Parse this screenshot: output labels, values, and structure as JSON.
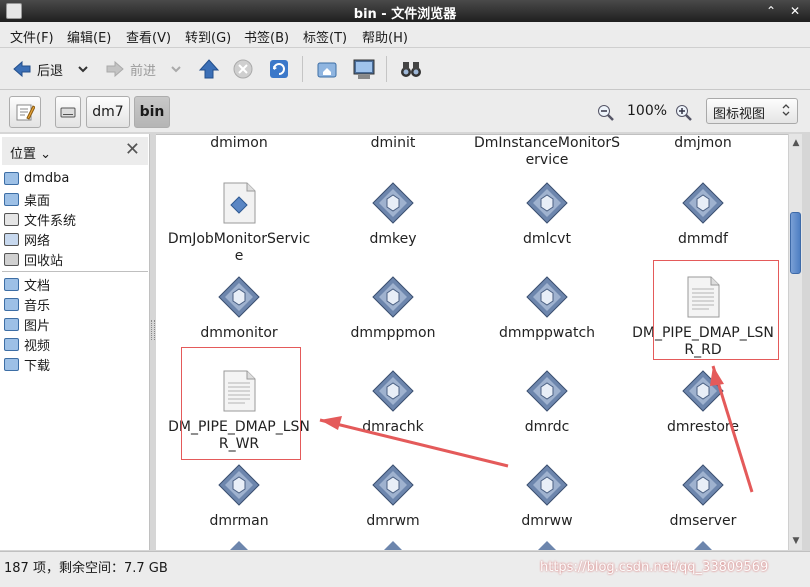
{
  "window": {
    "title": "bin - 文件浏览器",
    "controls": [
      "⌃",
      "✕"
    ]
  },
  "menu": [
    "文件(F)",
    "编辑(E)",
    "查看(V)",
    "转到(G)",
    "书签(B)",
    "标签(T)",
    "帮助(H)"
  ],
  "toolbar": {
    "back_label": "后退",
    "forward_label": "前进"
  },
  "location": {
    "path": [
      "dm7",
      "bin"
    ],
    "zoom": "100%",
    "view_mode": "图标视图"
  },
  "sidebar": {
    "header": "位置",
    "group1": [
      "dmdba",
      "桌面",
      "文件系统",
      "网络",
      "回收站"
    ],
    "group2": [
      "文档",
      "音乐",
      "图片",
      "视频",
      "下载"
    ]
  },
  "files": [
    {
      "name": "dmimon",
      "type": "exec"
    },
    {
      "name": "dminit",
      "type": "exec"
    },
    {
      "name": "DmInstanceMonitorService",
      "type": "exec"
    },
    {
      "name": "dmjmon",
      "type": "exec"
    },
    {
      "name": "DmJobMonitorService",
      "type": "script"
    },
    {
      "name": "dmkey",
      "type": "exec"
    },
    {
      "name": "dmlcvt",
      "type": "exec"
    },
    {
      "name": "dmmdf",
      "type": "exec"
    },
    {
      "name": "dmmonitor",
      "type": "exec"
    },
    {
      "name": "dmmppmon",
      "type": "exec"
    },
    {
      "name": "dmmppwatch",
      "type": "exec"
    },
    {
      "name": "DM_PIPE_DMAP_LSNR_RD",
      "type": "text"
    },
    {
      "name": "DM_PIPE_DMAP_LSNR_WR",
      "type": "text"
    },
    {
      "name": "dmrachk",
      "type": "exec"
    },
    {
      "name": "dmrdc",
      "type": "exec"
    },
    {
      "name": "dmrestore",
      "type": "exec"
    },
    {
      "name": "dmrman",
      "type": "exec"
    },
    {
      "name": "dmrwm",
      "type": "exec"
    },
    {
      "name": "dmrww",
      "type": "exec"
    },
    {
      "name": "dmserver",
      "type": "exec"
    }
  ],
  "status": {
    "text": "187 项，剩余空间：7.7 GB"
  },
  "watermark": "https://blog.csdn.net/qq_33809569",
  "colors": {
    "accent": "#4e7ec2",
    "annotation": "#e45a5a"
  }
}
